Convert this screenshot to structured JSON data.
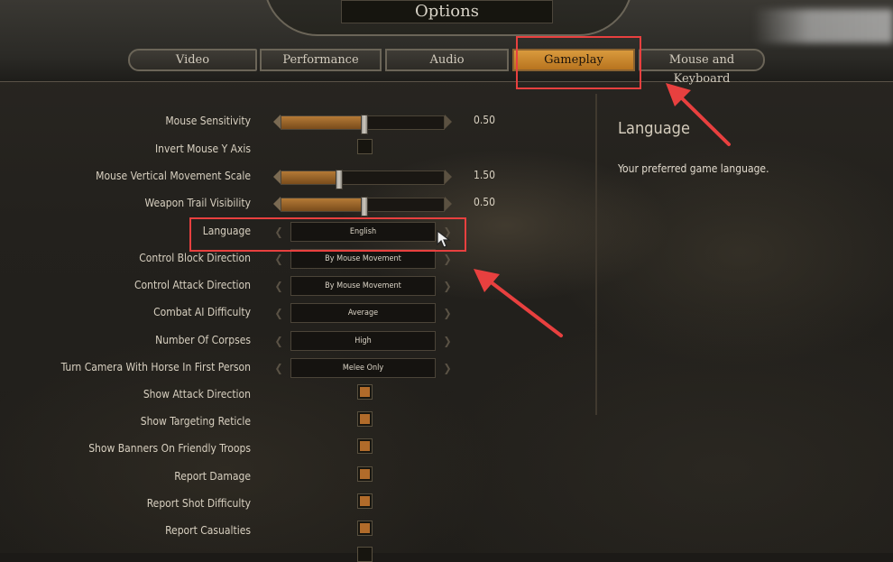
{
  "header": {
    "title": "Options"
  },
  "tabs": [
    {
      "label": "Video",
      "active": false
    },
    {
      "label": "Performance",
      "active": false
    },
    {
      "label": "Audio",
      "active": false
    },
    {
      "label": "Gameplay",
      "active": true
    },
    {
      "label": "Mouse and Keyboard",
      "active": false
    }
  ],
  "settings": {
    "mouse_sensitivity": {
      "label": "Mouse Sensitivity",
      "value": "0.50",
      "fill": 0.5
    },
    "invert_mouse_y": {
      "label": "Invert Mouse Y Axis",
      "checked": false
    },
    "mouse_vertical_scale": {
      "label": "Mouse Vertical Movement Scale",
      "value": "1.50",
      "fill": 0.35
    },
    "weapon_trail": {
      "label": "Weapon Trail Visibility",
      "value": "0.50",
      "fill": 0.5
    },
    "language": {
      "label": "Language",
      "value": "English"
    },
    "control_block": {
      "label": "Control Block Direction",
      "value": "By Mouse Movement"
    },
    "control_attack": {
      "label": "Control Attack Direction",
      "value": "By Mouse Movement"
    },
    "combat_ai": {
      "label": "Combat AI Difficulty",
      "value": "Average"
    },
    "corpses": {
      "label": "Number Of Corpses",
      "value": "High"
    },
    "turn_camera": {
      "label": "Turn Camera With Horse In First Person",
      "value": "Melee Only"
    },
    "show_attack_direction": {
      "label": "Show Attack Direction",
      "checked": true
    },
    "show_targeting_reticle": {
      "label": "Show Targeting Reticle",
      "checked": true
    },
    "show_banners": {
      "label": "Show Banners On Friendly Troops",
      "checked": true
    },
    "report_damage": {
      "label": "Report Damage",
      "checked": true
    },
    "report_shot_difficulty": {
      "label": "Report Shot Difficulty",
      "checked": true
    },
    "report_casualties": {
      "label": "Report Casualties",
      "checked": true
    }
  },
  "info": {
    "title": "Language",
    "description": "Your preferred game language."
  },
  "colors": {
    "accent": "#c88530",
    "highlight": "#e8403f"
  }
}
